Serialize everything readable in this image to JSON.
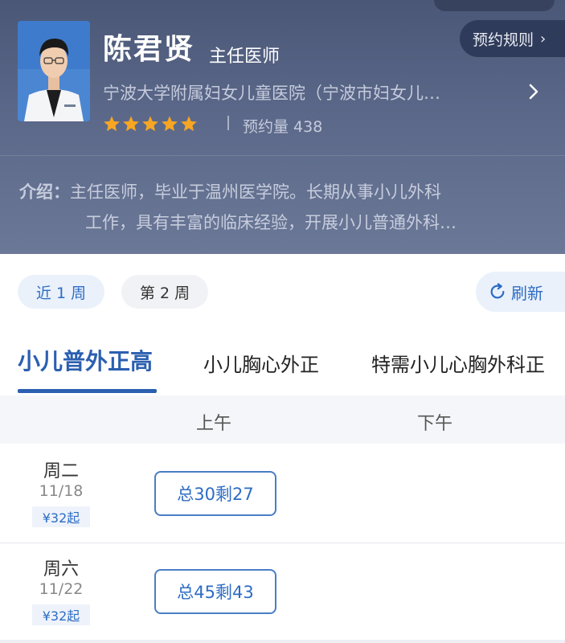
{
  "doctor": {
    "name": "陈君贤",
    "title": "主任医师",
    "hospital": "宁波大学附属妇女儿童医院（宁波市妇女儿…",
    "rating_stars": 5,
    "booking_count": "预约量 438",
    "rules_label": "预约规则"
  },
  "intro": {
    "label": "介绍：",
    "line1": "主任医师，毕业于温州医学院。长期从事小儿外科",
    "line2": "工作，具有丰富的临床经验，开展小儿普通外科…"
  },
  "weeks": {
    "week1": "近 1 周",
    "week2": "第 2 周",
    "refresh": "刷新"
  },
  "tabs": [
    "小儿普外正高",
    "小儿胸心外正",
    "特需小儿心胸外科正"
  ],
  "schedule": {
    "am_label": "上午",
    "pm_label": "下午",
    "rows": [
      {
        "day": "周二",
        "date": "11/18",
        "price": "¥32起",
        "am_slot": "总30剩27"
      },
      {
        "day": "周六",
        "date": "11/22",
        "price": "¥32起",
        "am_slot": "总45剩43"
      }
    ]
  },
  "colors": {
    "accent": "#2b5fb0",
    "header_bg": "#55627f",
    "star": "#f6a623"
  }
}
